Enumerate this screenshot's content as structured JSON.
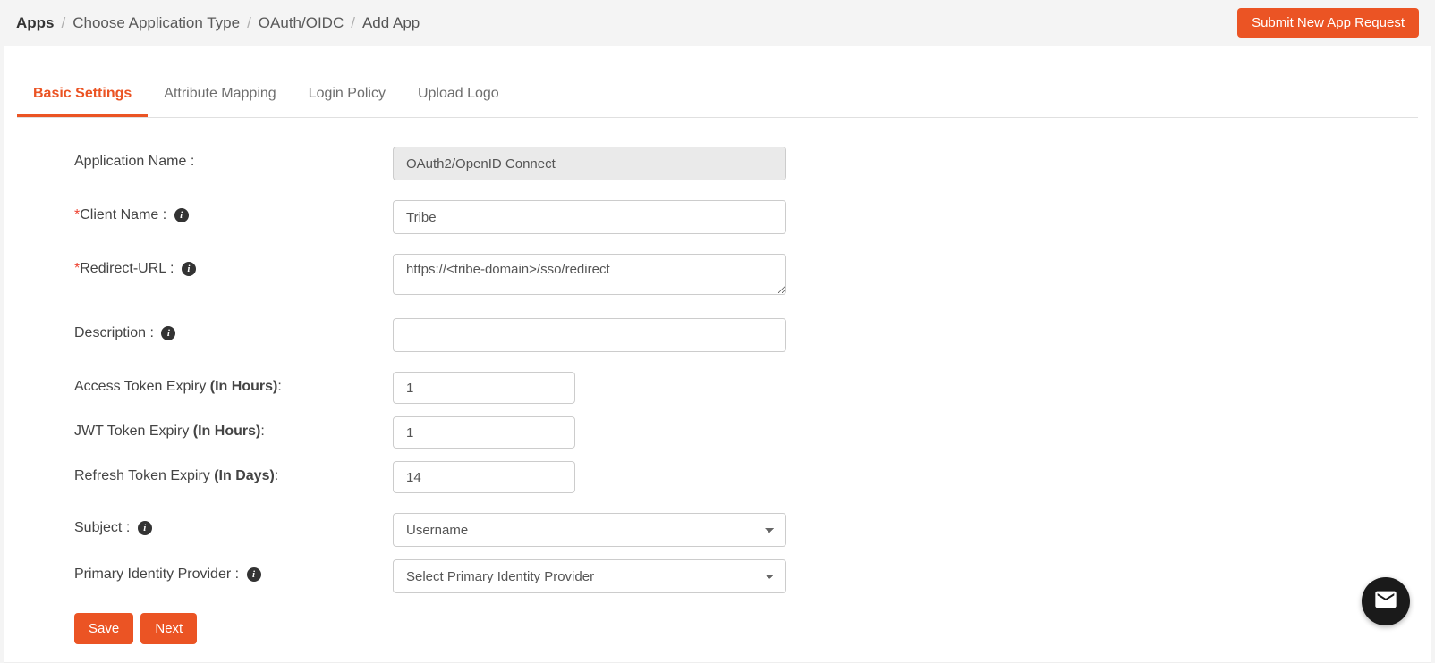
{
  "breadcrumb": {
    "items": [
      "Apps",
      "Choose Application Type",
      "OAuth/OIDC",
      "Add App"
    ]
  },
  "submit_request_label": "Submit New App Request",
  "tabs": [
    {
      "label": "Basic Settings"
    },
    {
      "label": "Attribute Mapping"
    },
    {
      "label": "Login Policy"
    },
    {
      "label": "Upload Logo"
    }
  ],
  "form": {
    "app_name": {
      "label": "Application Name :",
      "value": "OAuth2/OpenID Connect"
    },
    "client_name": {
      "label": "Client Name :",
      "value": "Tribe",
      "required": true
    },
    "redirect_url": {
      "label": "Redirect-URL :",
      "value": "https://<tribe-domain>/sso/redirect",
      "required": true
    },
    "description": {
      "label": "Description :",
      "value": ""
    },
    "access_token_expiry": {
      "label": "Access Token Expiry ",
      "unit": "(In Hours)",
      "colon": ":",
      "value": "1"
    },
    "jwt_token_expiry": {
      "label": "JWT Token Expiry ",
      "unit": "(In Hours)",
      "colon": ":",
      "value": "1"
    },
    "refresh_token_expiry": {
      "label": "Refresh Token Expiry ",
      "unit": "(In Days)",
      "colon": ":",
      "value": "14"
    },
    "subject": {
      "label": "Subject :",
      "selected": "Username"
    },
    "primary_idp": {
      "label": "Primary Identity Provider :",
      "selected": "Select Primary Identity Provider"
    }
  },
  "actions": {
    "save": "Save",
    "next": "Next"
  }
}
